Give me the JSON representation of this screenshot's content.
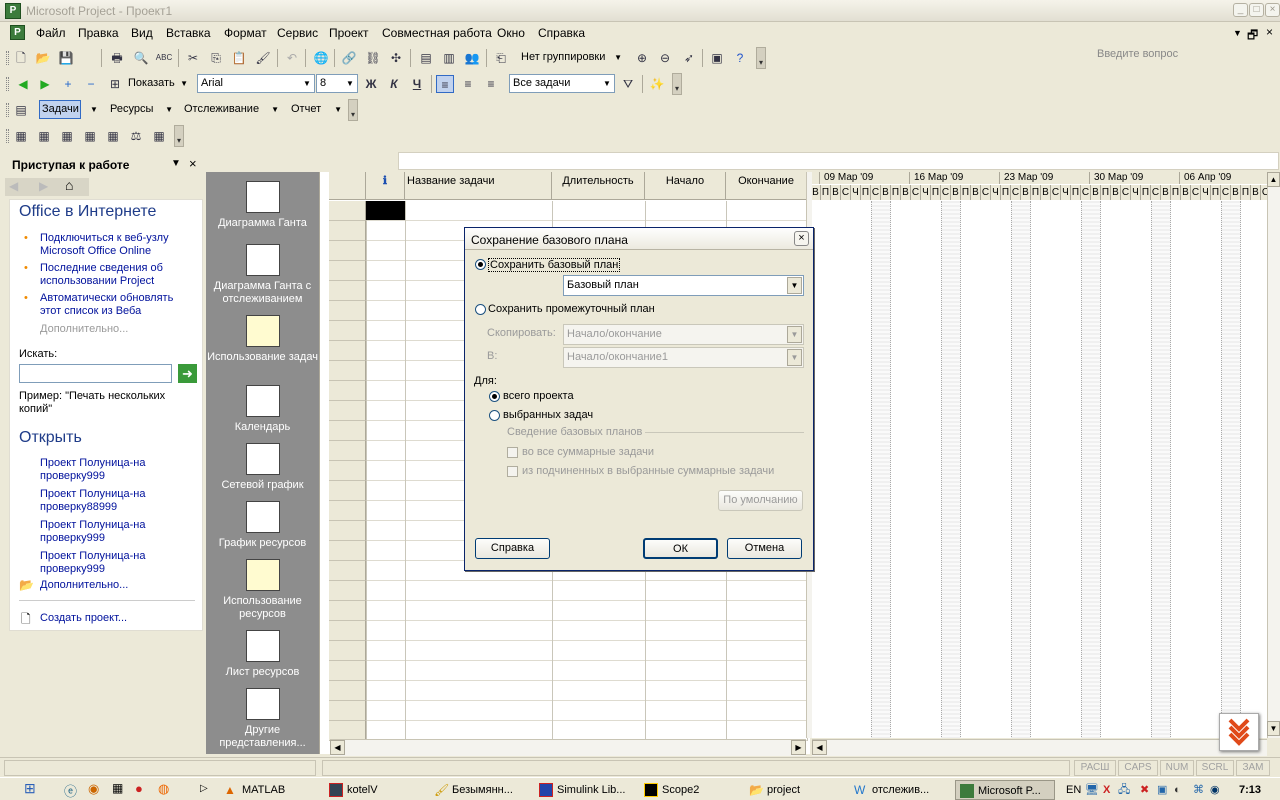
{
  "window": {
    "title": "Microsoft Project - Проект1",
    "app_icon": "project-icon"
  },
  "menu": [
    "Файл",
    "Правка",
    "Вид",
    "Вставка",
    "Формат",
    "Сервис",
    "Проект",
    "Совместная работа",
    "Окно",
    "Справка"
  ],
  "ask_question": "Введите вопрос",
  "toolbar1": {
    "grouping": "Нет группировки"
  },
  "toolbar2": {
    "show": "Показать",
    "font": "Arial",
    "size": "8",
    "bold": "Ж",
    "italic": "К",
    "underline": "Ч",
    "filter": "Все задачи"
  },
  "toolbar3": {
    "tasks": "Задачи",
    "resources": "Ресурсы",
    "tracking": "Отслеживание",
    "report": "Отчет"
  },
  "taskpane": {
    "title": "Приступая к работе",
    "section1": "Office в Интернете",
    "links": [
      "Подключиться к веб-узлу Microsoft Office Online",
      "Последние сведения об использовании Project",
      "Автоматически обновлять этот список из Веба"
    ],
    "more1": "Дополнительно...",
    "search_label": "Искать:",
    "search_value": "",
    "example": "Пример:  \"Печать нескольких копий\"",
    "section2": "Открыть",
    "files": [
      "Проект Полуница-на проверку999",
      "Проект Полуница-на проверку88999",
      "Проект Полуница-на проверку999",
      "Проект Полуница-на проверку999"
    ],
    "more2": "Дополнительно...",
    "create": "Создать проект..."
  },
  "viewbar": [
    "Диаграмма Ганта",
    "Диаграмма Ганта с отслеживанием",
    "Использование задач",
    "Календарь",
    "Сетевой график",
    "График ресурсов",
    "Использование ресурсов",
    "Лист ресурсов",
    "Другие представления..."
  ],
  "table": {
    "columns": [
      "Название задачи",
      "Длительность",
      "Начало",
      "Окончание"
    ]
  },
  "gantt": {
    "weeks": [
      "09 Мар '09",
      "16 Мар '09",
      "23 Мар '09",
      "30 Мар '09",
      "06 Апр '09"
    ],
    "days": [
      "В",
      "П",
      "В",
      "С",
      "Ч",
      "П",
      "С"
    ]
  },
  "dialog": {
    "title": "Сохранение базового плана",
    "save_baseline": "Сохранить базовый план",
    "baseline_select": "Базовый план",
    "save_interim": "Сохранить промежуточный план",
    "copy_label": "Скопировать:",
    "copy_value": "Начало/окончание",
    "into_label": "В:",
    "into_value": "Начало/окончание1",
    "for_label": "Для:",
    "whole_project": "всего проекта",
    "selected_tasks": "выбранных задач",
    "rollup_group": "Сведение базовых планов",
    "rollup1": "во все суммарные задачи",
    "rollup2": "из подчиненных в выбранные суммарные задачи",
    "default_btn": "По умолчанию",
    "help_btn": "Справка",
    "ok_btn": "ОК",
    "cancel_btn": "Отмена"
  },
  "status": [
    "РАСШ",
    "CAPS",
    "NUM",
    "SCRL",
    "ЗАМ"
  ],
  "taskbar": {
    "items": [
      "MATLAB",
      "kotelV",
      "Безымянн...",
      "Simulink Lib...",
      "Scope2",
      "project",
      "отслежив...",
      "Microsoft P..."
    ],
    "lang": "EN",
    "time": "7:13"
  }
}
